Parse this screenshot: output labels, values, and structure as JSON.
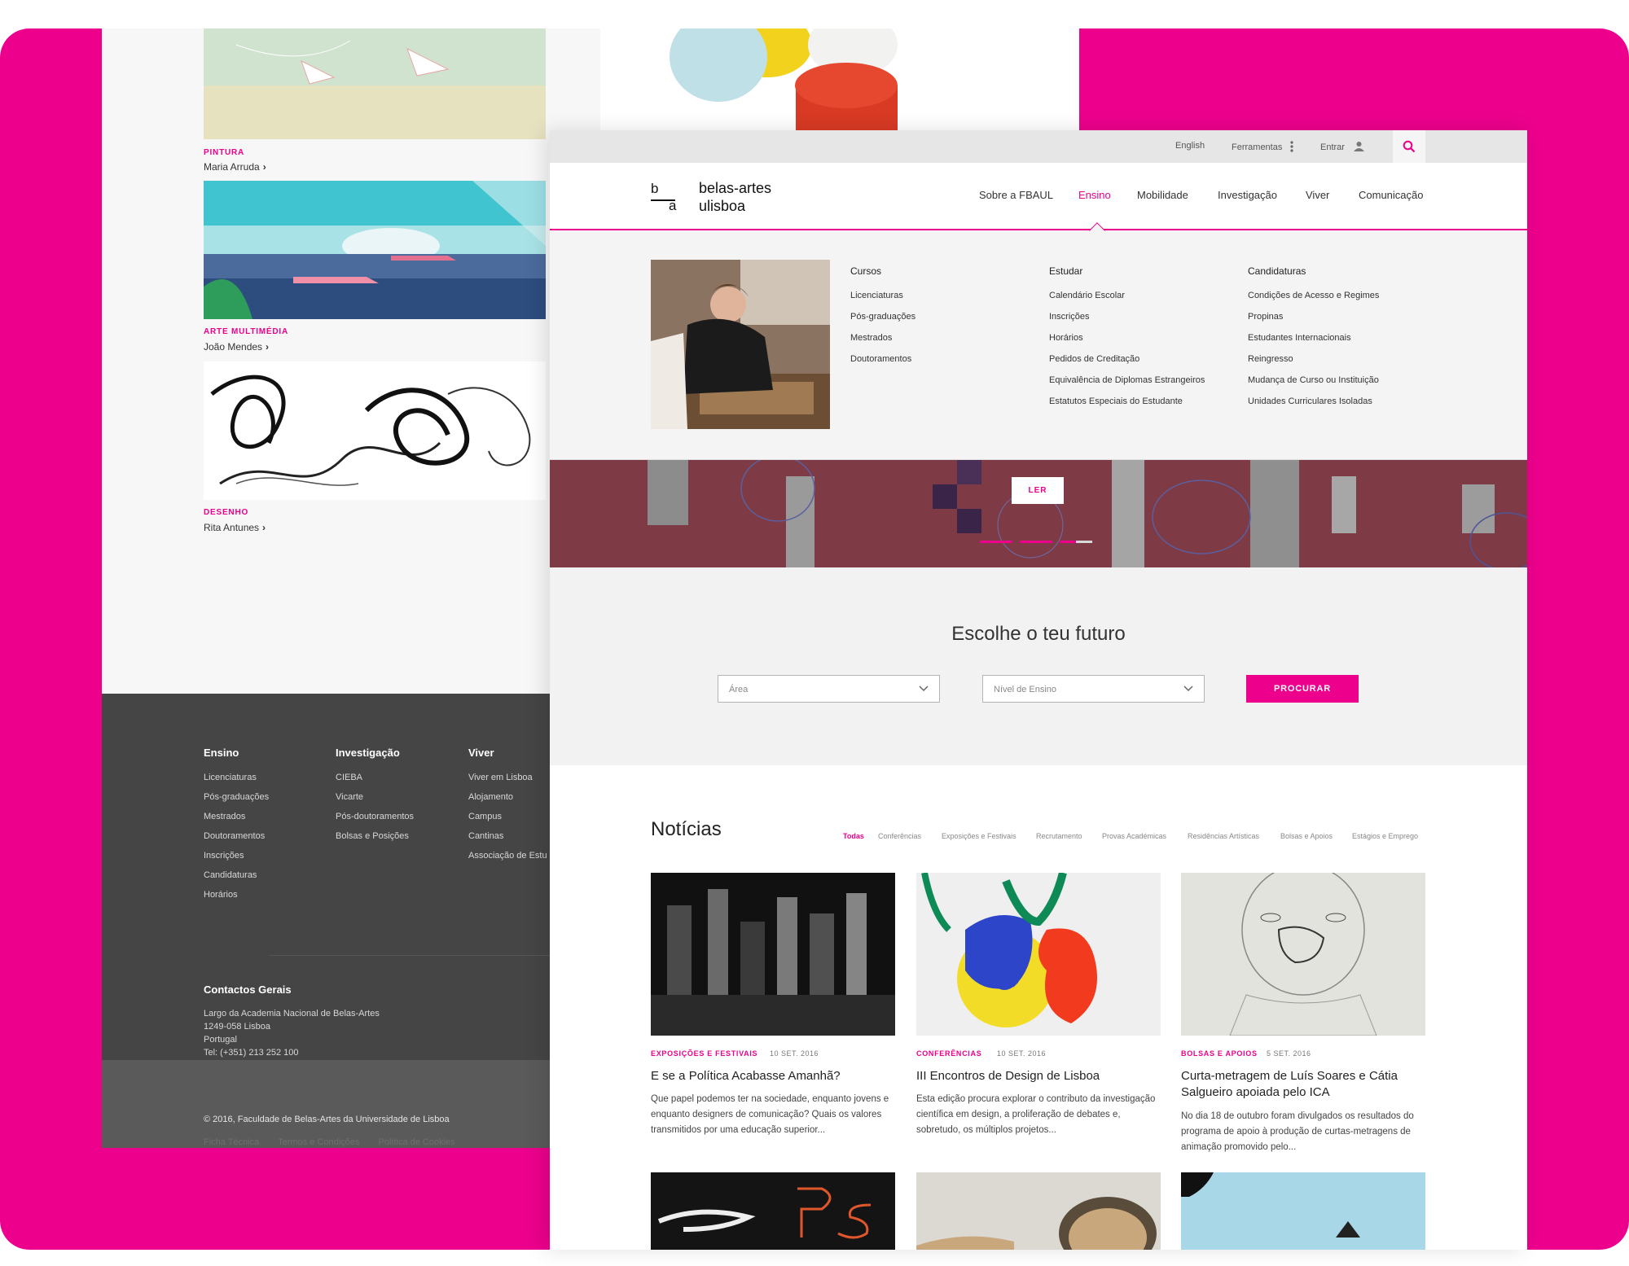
{
  "colors": {
    "accent": "#ec008c",
    "footer_dark": "#454545",
    "hero_wine": "#7e3b45"
  },
  "back_page": {
    "gallery": [
      {
        "category": "PINTURA",
        "artist": "Maria Arruda"
      },
      {
        "category": "ARTE MULTIMÉDIA",
        "artist": "João Mendes"
      },
      {
        "category": "DESENHO",
        "artist": "Rita Antunes"
      }
    ],
    "chevron": "›",
    "footer": {
      "columns": [
        {
          "title": "Ensino",
          "items": [
            "Licenciaturas",
            "Pós-graduações",
            "Mestrados",
            "Doutoramentos",
            "Inscrições",
            "Candidaturas",
            "Horários"
          ]
        },
        {
          "title": "Investigação",
          "items": [
            "CIEBA",
            "Vicarte",
            "Pós-doutoramentos",
            "Bolsas e Posições"
          ]
        },
        {
          "title": "Viver",
          "items": [
            "Viver em Lisboa",
            "Alojamento",
            "Campus",
            "Cantinas",
            "Associação de Estu"
          ]
        }
      ],
      "contact_title": "Contactos Gerais",
      "contact_lines": [
        "Largo da Academia Nacional de Belas-Artes",
        "1249-058 Lisboa",
        "Portugal",
        "Tel: (+351) 213 252 100"
      ],
      "copyright": "© 2016, Faculdade de Belas-Artes da Universidade de Lisboa",
      "legal_links": [
        "Ficha Técnica",
        "Termos e Condições",
        "Política de Cookies"
      ]
    }
  },
  "front_page": {
    "topbar": {
      "language": "English",
      "tools": "Ferramentas",
      "login": "Entrar",
      "search_icon": "search-icon"
    },
    "logo": {
      "b": "b",
      "a": "a",
      "line1": "belas-artes",
      "line2": "ulisboa"
    },
    "nav": [
      "Sobre a FBAUL",
      "Ensino",
      "Mobilidade",
      "Investigação",
      "Viver",
      "Comunicação"
    ],
    "nav_active": "Ensino",
    "mega_menu": [
      {
        "title": "Cursos",
        "items": [
          "Licenciaturas",
          "Pós-graduações",
          "Mestrados",
          "Doutoramentos"
        ]
      },
      {
        "title": "Estudar",
        "items": [
          "Calendário Escolar",
          "Inscrições",
          "Horários",
          "Pedidos de Creditação",
          "Equivalência de Diplomas Estrangeiros",
          "Estatutos Especiais do Estudante"
        ]
      },
      {
        "title": "Candidaturas",
        "items": [
          "Condições de Acesso e Regimes",
          "Propinas",
          "Estudantes Internacionais",
          "Reingresso",
          "Mudança de Curso ou Instituição",
          "Unidades Curriculares Isoladas"
        ]
      }
    ],
    "hero": {
      "button": "LER",
      "slides": 3,
      "active_slide": 3
    },
    "future": {
      "title": "Escolhe o teu futuro",
      "area_placeholder": "Área",
      "level_placeholder": "Nível de Ensino",
      "button": "PROCURAR"
    },
    "news": {
      "title": "Notícias",
      "filters": [
        "Todas",
        "Conferências",
        "Exposições e Festivais",
        "Recrutamento",
        "Provas Académicas",
        "Residências Artísticas",
        "Bolsas e Apoios",
        "Estágios e Emprego"
      ],
      "active_filter": "Todas",
      "cards": [
        {
          "category": "EXPOSIÇÕES E FESTIVAIS",
          "date": "10 SET. 2016",
          "title": "E se a Política Acabasse Amanhã?",
          "excerpt": "Que papel podemos ter na sociedade, enquanto jovens e enquanto designers de comunicação? Quais os valores transmitidos por uma educação superior..."
        },
        {
          "category": "CONFERÊNCIAS",
          "date": "10 SET. 2016",
          "title": "III Encontros de Design de Lisboa",
          "excerpt": "Esta edição procura explorar o contributo da investigação científica em design, a proliferação de debates e, sobretudo, os múltiplos projetos..."
        },
        {
          "category": "BOLSAS E APOIOS",
          "date": "5 SET. 2016",
          "title": "Curta-metragem de Luís Soares e Cátia Salgueiro apoiada pelo ICA",
          "excerpt": "No dia 18 de outubro foram divulgados os resultados do programa de apoio à produção de curtas-metragens de animação promovido pelo..."
        }
      ]
    }
  }
}
